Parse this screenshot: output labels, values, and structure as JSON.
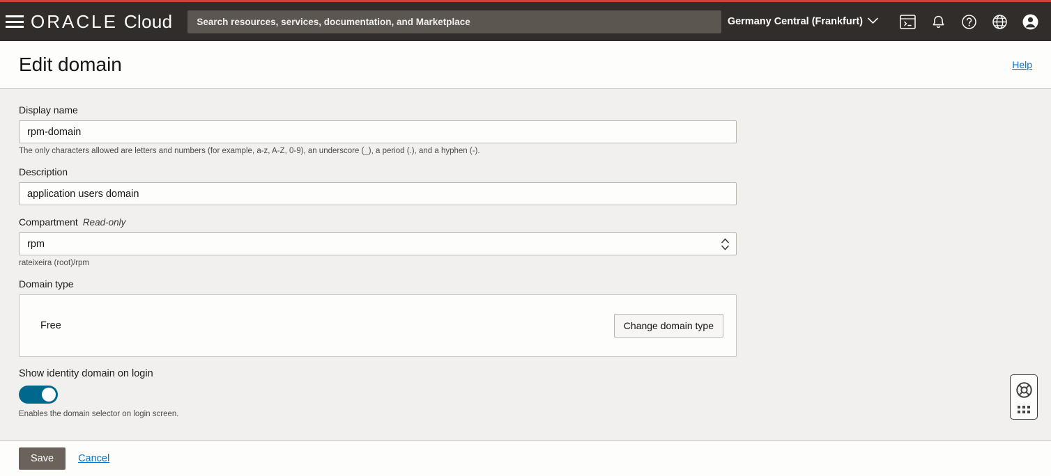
{
  "header": {
    "brand_oracle": "ORACLE",
    "brand_cloud": "Cloud",
    "search_placeholder": "Search resources, services, documentation, and Marketplace",
    "region": "Germany Central (Frankfurt)",
    "icons": [
      "cloud-shell-icon",
      "notifications-bell-icon",
      "help-circle-icon",
      "language-globe-icon",
      "user-avatar-icon"
    ],
    "accent_color": "#c74634",
    "bar_color": "#312d2a"
  },
  "titlebar": {
    "title": "Edit domain",
    "help": "Help",
    "link_color": "#0572ce"
  },
  "form": {
    "display_name": {
      "label": "Display name",
      "value": "rpm-domain",
      "helper": "The only characters allowed are letters and numbers (for example, a-z, A-Z, 0-9), an underscore (_), a period (.), and a hyphen (-)."
    },
    "description": {
      "label": "Description",
      "value": "application users domain"
    },
    "compartment": {
      "label": "Compartment",
      "readonly_tag": "Read-only",
      "value": "rpm",
      "helper": "rateixeira (root)/rpm"
    },
    "domain_type": {
      "label": "Domain type",
      "value": "Free",
      "change_button": "Change domain type"
    },
    "show_domain_toggle": {
      "label": "Show identity domain on login",
      "state": "on",
      "helper": "Enables the domain selector on login screen.",
      "on_color": "#00688c"
    }
  },
  "footer": {
    "save": "Save",
    "cancel": "Cancel"
  },
  "help_widget": {
    "icon": "lifebuoy-icon",
    "handle": "drag-dots-handle"
  }
}
